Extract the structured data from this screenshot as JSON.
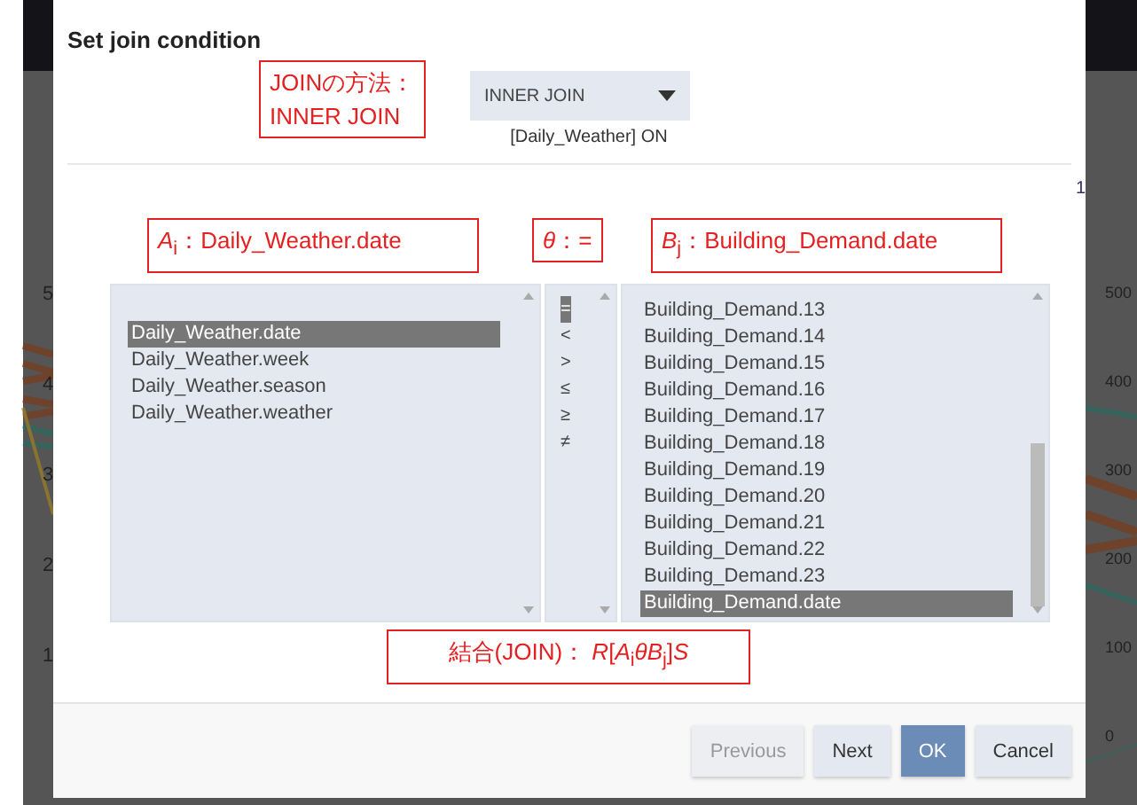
{
  "backdrop": {
    "left_ticks": [
      "5",
      "4",
      "3",
      "2",
      "1"
    ],
    "right_ticks": [
      "500",
      "400",
      "300",
      "200",
      "100",
      "0"
    ]
  },
  "dialog": {
    "title": "Set join condition",
    "join_type": {
      "value": "INNER JOIN"
    },
    "on_label": "[Daily_Weather] ON",
    "page_number": "1"
  },
  "annotations": [
    {
      "kind": "method",
      "text": "JOINの方法：\nINNER JOIN"
    },
    {
      "kind": "left",
      "text": "*A*$_{i}$：Daily_Weather.date"
    },
    {
      "kind": "op",
      "text": "*θ*：="
    },
    {
      "kind": "right",
      "text": "*B*$_{j}$：Building_Demand.date"
    },
    {
      "kind": "formula",
      "text": "結合(JOIN)： *R*[*A*$_{i}$*θB*$_{j}$]*S*"
    }
  ],
  "left_columns": [
    {
      "label": "Daily_Weather.date",
      "selected": true
    },
    {
      "label": "Daily_Weather.week",
      "selected": false
    },
    {
      "label": "Daily_Weather.season",
      "selected": false
    },
    {
      "label": "Daily_Weather.weather",
      "selected": false
    }
  ],
  "operators": [
    {
      "label": "=",
      "selected": true
    },
    {
      "label": "<",
      "selected": false
    },
    {
      "label": ">",
      "selected": false
    },
    {
      "label": "≤",
      "selected": false
    },
    {
      "label": "≥",
      "selected": false
    },
    {
      "label": "≠",
      "selected": false
    }
  ],
  "right_columns": [
    {
      "label": "Building_Demand.13",
      "selected": false
    },
    {
      "label": "Building_Demand.14",
      "selected": false
    },
    {
      "label": "Building_Demand.15",
      "selected": false
    },
    {
      "label": "Building_Demand.16",
      "selected": false
    },
    {
      "label": "Building_Demand.17",
      "selected": false
    },
    {
      "label": "Building_Demand.18",
      "selected": false
    },
    {
      "label": "Building_Demand.19",
      "selected": false
    },
    {
      "label": "Building_Demand.20",
      "selected": false
    },
    {
      "label": "Building_Demand.21",
      "selected": false
    },
    {
      "label": "Building_Demand.22",
      "selected": false
    },
    {
      "label": "Building_Demand.23",
      "selected": false
    },
    {
      "label": "Building_Demand.date",
      "selected": true
    }
  ],
  "buttons": [
    {
      "kind": "secondary",
      "label": "Previous",
      "disabled": true
    },
    {
      "kind": "secondary",
      "label": "Next",
      "disabled": false
    },
    {
      "kind": "primary",
      "label": "OK",
      "disabled": false
    },
    {
      "kind": "secondary",
      "label": "Cancel",
      "disabled": false
    }
  ]
}
